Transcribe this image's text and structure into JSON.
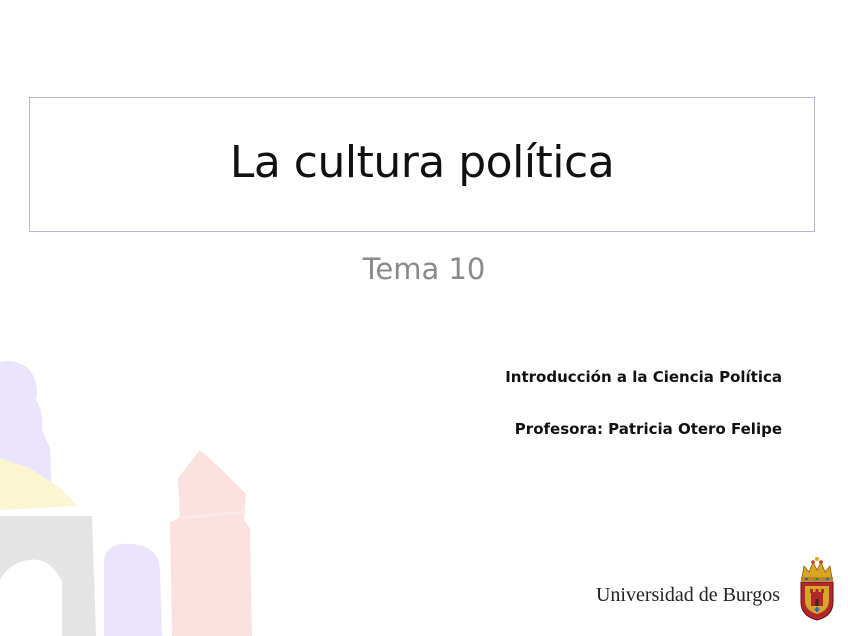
{
  "slide": {
    "title": "La cultura política",
    "subtitle": "Tema 10",
    "course": "Introducción a la Ciencia Política",
    "teacher": "Profesora: Patricia Otero Felipe",
    "university": "Universidad de Burgos"
  },
  "colors": {
    "title_border": "#b9b4dc",
    "subtitle_text": "#8a8a8a",
    "deco_lavender": "#e9e4fb",
    "deco_yellow": "#fbf5d2",
    "deco_gray": "#e4e4e4",
    "deco_pink": "#fbe0e0"
  },
  "icons": {
    "crest": "university-crest-icon",
    "decoration": "decorative-building-shapes"
  }
}
